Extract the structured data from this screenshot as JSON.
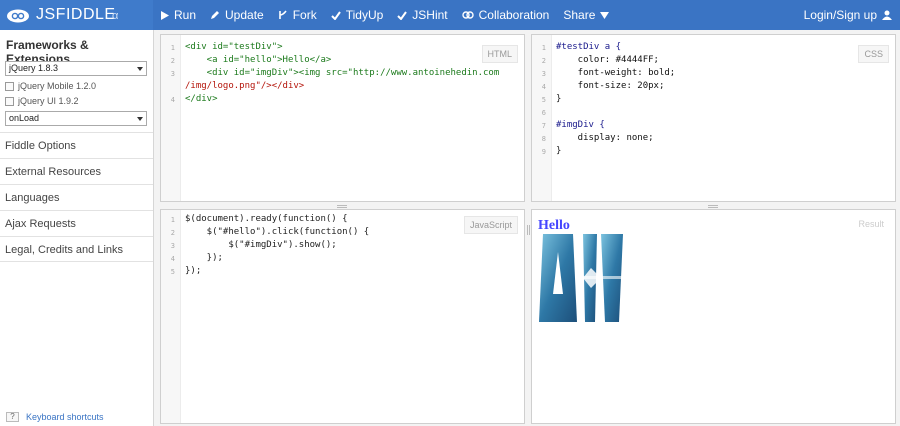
{
  "header": {
    "brand": "JSFIDDLE",
    "brand_suffix": "α",
    "actions": [
      {
        "label": "Run",
        "icon": "play-icon"
      },
      {
        "label": "Update",
        "icon": "pencil-icon"
      },
      {
        "label": "Fork",
        "icon": "fork-icon"
      },
      {
        "label": "TidyUp",
        "icon": "check-icon"
      },
      {
        "label": "JSHint",
        "icon": "check-icon"
      },
      {
        "label": "Collaboration",
        "icon": "collaboration-icon"
      },
      {
        "label": "Share",
        "icon": "caret-down-icon"
      }
    ],
    "login": "Login/Sign up"
  },
  "sidebar": {
    "title": "Frameworks & Extensions",
    "framework_select": "jQuery 1.8.3",
    "extensions": [
      "jQuery Mobile 1.2.0",
      "jQuery UI 1.9.2"
    ],
    "load_select": "onLoad",
    "items": [
      "Fiddle Options",
      "External Resources",
      "Languages",
      "Ajax Requests",
      "Legal, Credits and Links"
    ],
    "shortcut_key": "?",
    "shortcut_label": "Keyboard shortcuts"
  },
  "panels": {
    "html": {
      "label": "HTML",
      "line_numbers": [
        "1",
        "2",
        "3",
        "4"
      ],
      "lines": [
        "<div id=\"testDiv\">",
        "    <a id=\"hello\">Hello</a>",
        "    <div id=\"imgDiv\"><img src=\"http://www.antoinehedin.com",
        "/img/logo.png\"/></div>",
        "</div>"
      ]
    },
    "css": {
      "label": "CSS",
      "line_numbers": [
        "1",
        "2",
        "3",
        "4",
        "5",
        "6",
        "7",
        "8",
        "9"
      ],
      "lines": [
        "#testDiv a {",
        "    color: #4444FF;",
        "    font-weight: bold;",
        "    font-size: 20px;",
        "}",
        "",
        "#imgDiv {",
        "    display: none;",
        "}"
      ]
    },
    "js": {
      "label": "JavaScript",
      "line_numbers": [
        "1",
        "2",
        "3",
        "4",
        "5"
      ],
      "lines": [
        "$(document).ready(function() {",
        "    $(\"#hello\").click(function() {",
        "        $(\"#imgDiv\").show();",
        "    });",
        "});"
      ]
    },
    "result": {
      "label": "Result",
      "hello_text": "Hello"
    }
  },
  "colors": {
    "topbar": "#3a74c4",
    "hello_link": "#4444FF",
    "logo_blue": "#2e78a6"
  }
}
